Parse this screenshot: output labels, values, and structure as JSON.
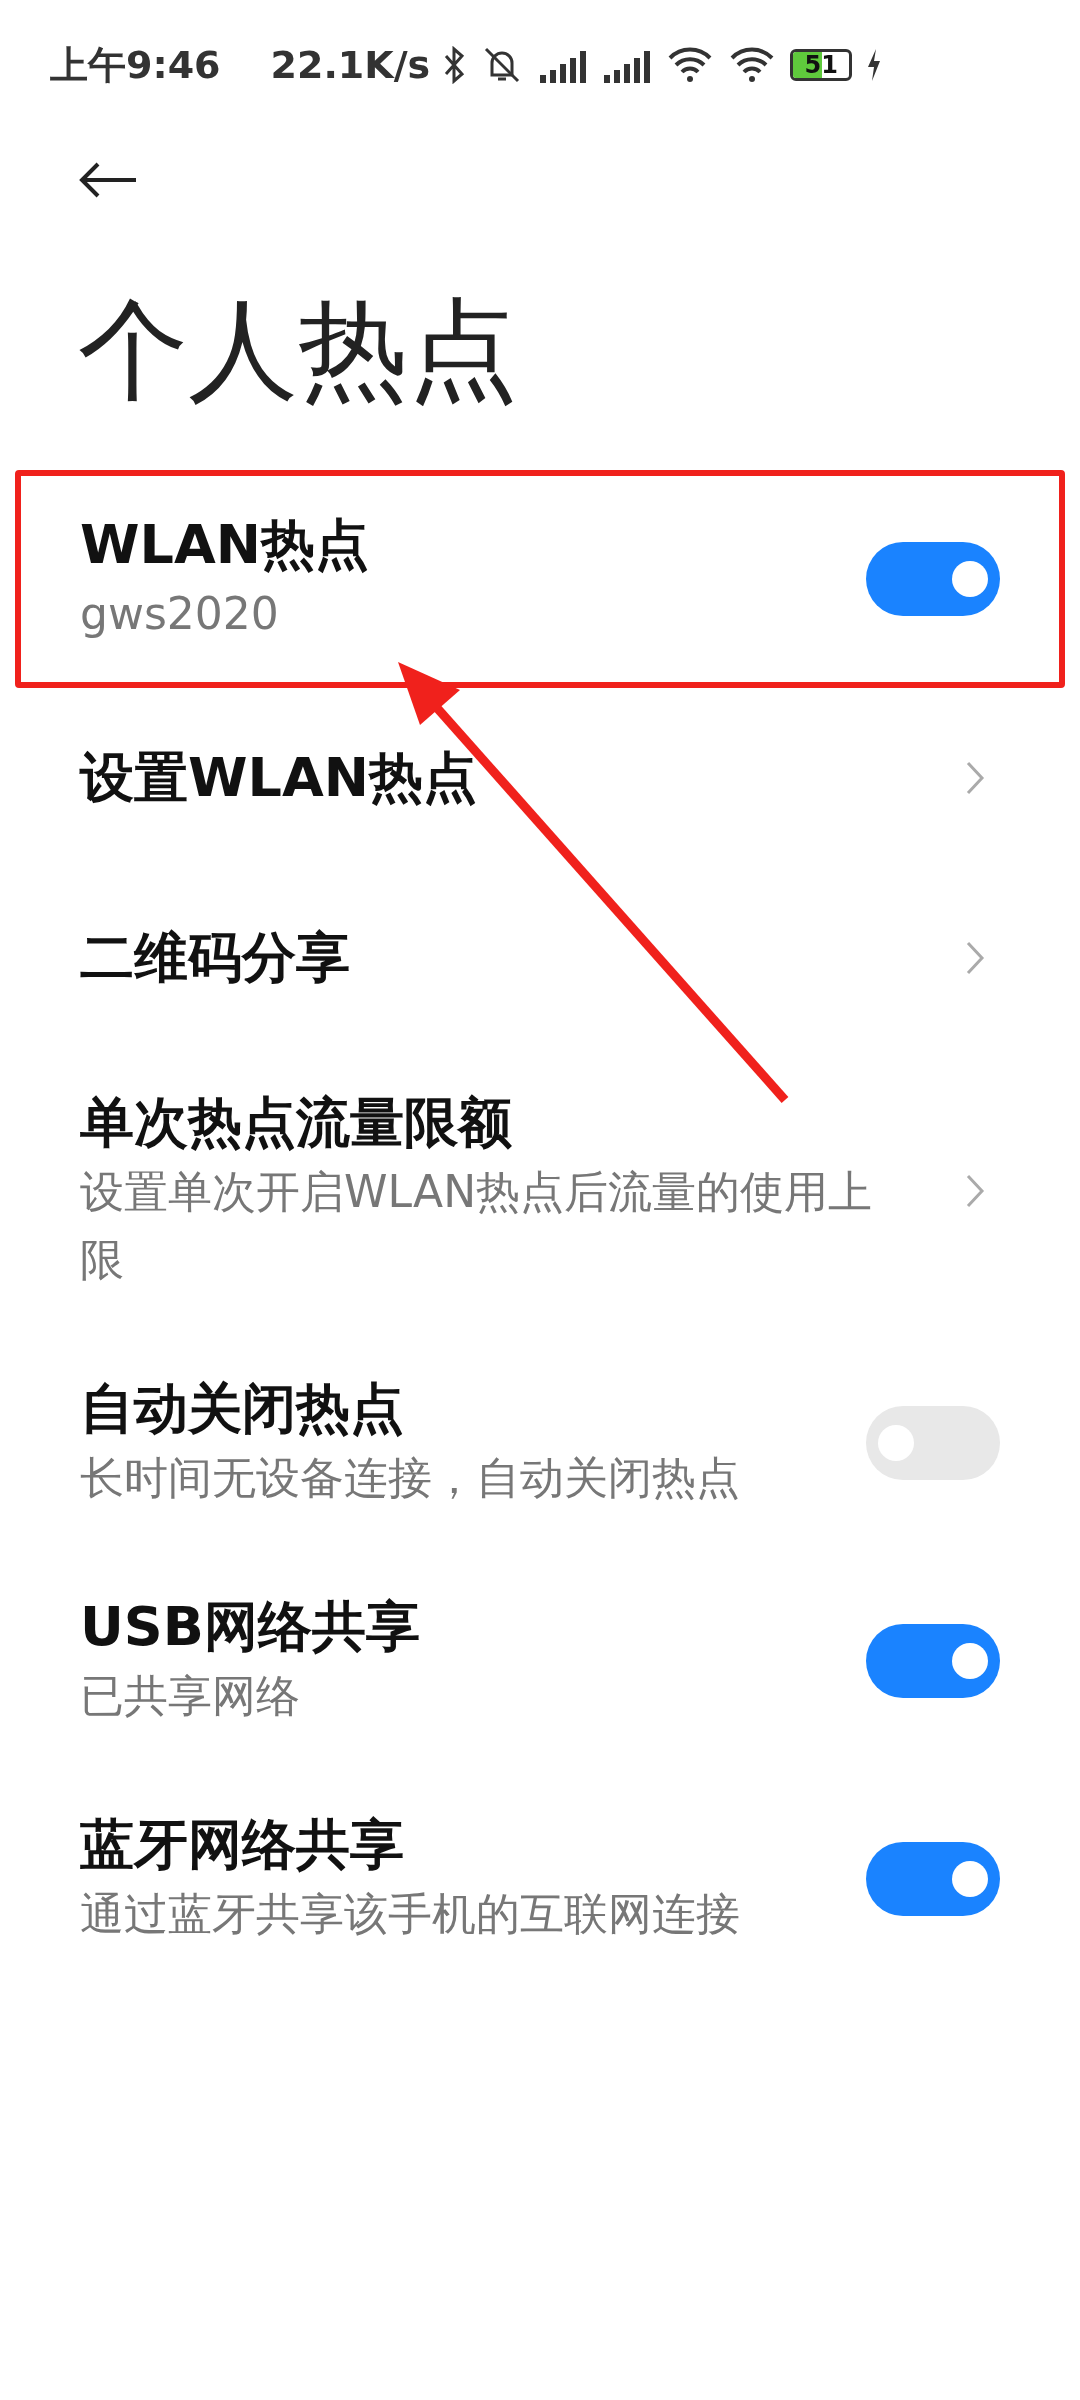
{
  "status_bar": {
    "time": "上午9:46",
    "speed": "22.1K/s",
    "battery": "51"
  },
  "title": "个人热点",
  "items": [
    {
      "kind": "toggle",
      "title": "WLAN热点",
      "subtitle": "gws2020",
      "on": true,
      "highlighted": true
    },
    {
      "kind": "link",
      "title": "设置WLAN热点"
    },
    {
      "kind": "link",
      "title": "二维码分享"
    },
    {
      "kind": "link",
      "title": "单次热点流量限额",
      "subtitle": "设置单次开启WLAN热点后流量的使用上限"
    },
    {
      "kind": "toggle",
      "title": "自动关闭热点",
      "subtitle": "长时间无设备连接，自动关闭热点",
      "on": false
    },
    {
      "kind": "toggle",
      "title": "USB网络共享",
      "subtitle": "已共享网络",
      "on": true
    },
    {
      "kind": "toggle",
      "title": "蓝牙网络共享",
      "subtitle": "通过蓝牙共享该手机的互联网连接",
      "on": true
    }
  ]
}
